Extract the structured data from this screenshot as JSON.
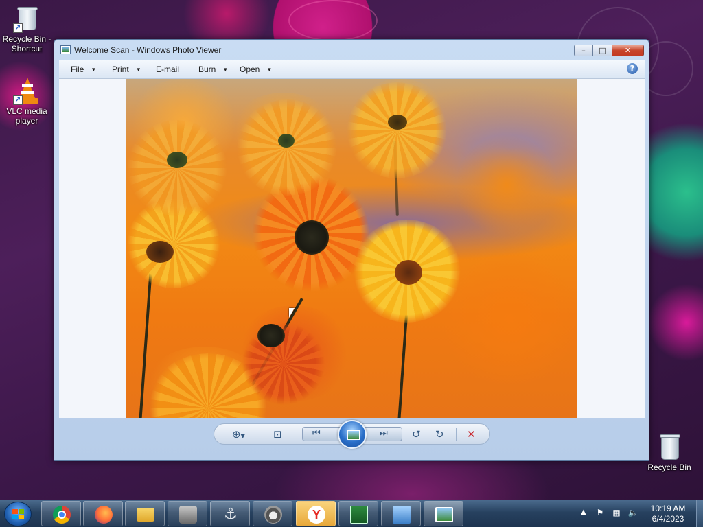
{
  "desktop": {
    "icons": [
      {
        "label": "Recycle Bin - Shortcut",
        "line1": "Recycle Bin -",
        "line2": "Shortcut",
        "icon": "recycle-bin-icon"
      },
      {
        "label": "VLC media player",
        "line1": "VLC media",
        "line2": "player",
        "icon": "vlc-cone-icon"
      },
      {
        "label": "Recycle Bin",
        "line1": "Recycle Bin",
        "line2": "",
        "icon": "recycle-bin-icon"
      }
    ]
  },
  "window": {
    "title": "Welcome Scan - Windows Photo Viewer",
    "controls": {
      "minimize": "–",
      "maximize": "□",
      "close": "✕"
    },
    "menu": [
      {
        "label": "File",
        "has_dropdown": true
      },
      {
        "label": "Print",
        "has_dropdown": true
      },
      {
        "label": "E-mail",
        "has_dropdown": false
      },
      {
        "label": "Burn",
        "has_dropdown": true
      },
      {
        "label": "Open",
        "has_dropdown": true
      }
    ],
    "help_symbol": "?",
    "toolbar_icons": [
      "zoom-icon",
      "fit-to-window-icon",
      "previous-icon",
      "slideshow-icon",
      "next-icon",
      "rotate-counterclockwise-icon",
      "rotate-clockwise-icon",
      "delete-icon"
    ],
    "colors": {
      "delete": "#c8252b",
      "accent": "#2a6fc9"
    }
  },
  "taskbar": {
    "apps": [
      "chrome-icon",
      "firefox-icon",
      "file-explorer-icon",
      "world-of-tanks-icon",
      "world-of-warships-icon",
      "raccoon-app-icon",
      "yandex-browser-icon",
      "network-monitor-icon",
      "control-panel-icon",
      "photo-viewer-icon"
    ],
    "yandex_letter": "Y",
    "tray_arrow": "▲",
    "clock": {
      "time": "10:19 AM",
      "date": "6/4/2023"
    }
  }
}
